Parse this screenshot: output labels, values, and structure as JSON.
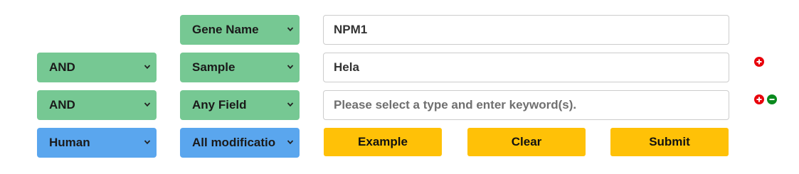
{
  "rows": [
    {
      "field": "Gene Name",
      "value": "NPM1"
    },
    {
      "operator": "AND",
      "field": "Sample",
      "value": "Hela"
    },
    {
      "operator": "AND",
      "field": "Any Field",
      "placeholder": "Please select a type and enter keyword(s)."
    }
  ],
  "filters": {
    "species": "Human",
    "modification": "All modificatio"
  },
  "buttons": {
    "example": "Example",
    "clear": "Clear",
    "submit": "Submit"
  },
  "icons": {
    "add": "plus-circle-icon",
    "remove": "minus-circle-icon",
    "dropdown": "chevron-down-icon"
  },
  "colors": {
    "select_green": "#76c893",
    "select_blue": "#5aa6ee",
    "button_yellow": "#ffc107",
    "add_red": "#e8000b",
    "remove_green": "#0a8a1e"
  }
}
